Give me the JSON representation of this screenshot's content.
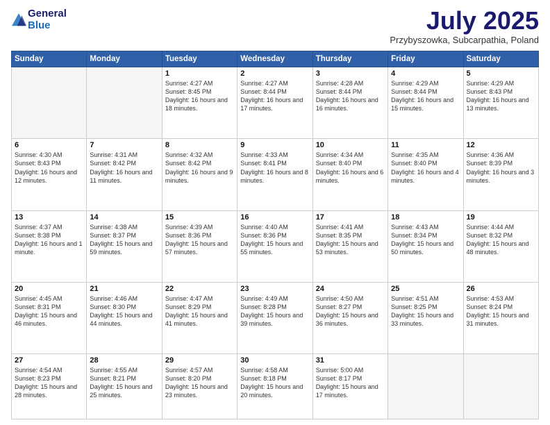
{
  "header": {
    "logo_line1": "General",
    "logo_line2": "Blue",
    "month": "July 2025",
    "location": "Przybyszowka, Subcarpathia, Poland"
  },
  "days_of_week": [
    "Sunday",
    "Monday",
    "Tuesday",
    "Wednesday",
    "Thursday",
    "Friday",
    "Saturday"
  ],
  "weeks": [
    [
      {
        "day": "",
        "text": ""
      },
      {
        "day": "",
        "text": ""
      },
      {
        "day": "1",
        "text": "Sunrise: 4:27 AM\nSunset: 8:45 PM\nDaylight: 16 hours and 18 minutes."
      },
      {
        "day": "2",
        "text": "Sunrise: 4:27 AM\nSunset: 8:44 PM\nDaylight: 16 hours and 17 minutes."
      },
      {
        "day": "3",
        "text": "Sunrise: 4:28 AM\nSunset: 8:44 PM\nDaylight: 16 hours and 16 minutes."
      },
      {
        "day": "4",
        "text": "Sunrise: 4:29 AM\nSunset: 8:44 PM\nDaylight: 16 hours and 15 minutes."
      },
      {
        "day": "5",
        "text": "Sunrise: 4:29 AM\nSunset: 8:43 PM\nDaylight: 16 hours and 13 minutes."
      }
    ],
    [
      {
        "day": "6",
        "text": "Sunrise: 4:30 AM\nSunset: 8:43 PM\nDaylight: 16 hours and 12 minutes."
      },
      {
        "day": "7",
        "text": "Sunrise: 4:31 AM\nSunset: 8:42 PM\nDaylight: 16 hours and 11 minutes."
      },
      {
        "day": "8",
        "text": "Sunrise: 4:32 AM\nSunset: 8:42 PM\nDaylight: 16 hours and 9 minutes."
      },
      {
        "day": "9",
        "text": "Sunrise: 4:33 AM\nSunset: 8:41 PM\nDaylight: 16 hours and 8 minutes."
      },
      {
        "day": "10",
        "text": "Sunrise: 4:34 AM\nSunset: 8:40 PM\nDaylight: 16 hours and 6 minutes."
      },
      {
        "day": "11",
        "text": "Sunrise: 4:35 AM\nSunset: 8:40 PM\nDaylight: 16 hours and 4 minutes."
      },
      {
        "day": "12",
        "text": "Sunrise: 4:36 AM\nSunset: 8:39 PM\nDaylight: 16 hours and 3 minutes."
      }
    ],
    [
      {
        "day": "13",
        "text": "Sunrise: 4:37 AM\nSunset: 8:38 PM\nDaylight: 16 hours and 1 minute."
      },
      {
        "day": "14",
        "text": "Sunrise: 4:38 AM\nSunset: 8:37 PM\nDaylight: 15 hours and 59 minutes."
      },
      {
        "day": "15",
        "text": "Sunrise: 4:39 AM\nSunset: 8:36 PM\nDaylight: 15 hours and 57 minutes."
      },
      {
        "day": "16",
        "text": "Sunrise: 4:40 AM\nSunset: 8:36 PM\nDaylight: 15 hours and 55 minutes."
      },
      {
        "day": "17",
        "text": "Sunrise: 4:41 AM\nSunset: 8:35 PM\nDaylight: 15 hours and 53 minutes."
      },
      {
        "day": "18",
        "text": "Sunrise: 4:43 AM\nSunset: 8:34 PM\nDaylight: 15 hours and 50 minutes."
      },
      {
        "day": "19",
        "text": "Sunrise: 4:44 AM\nSunset: 8:32 PM\nDaylight: 15 hours and 48 minutes."
      }
    ],
    [
      {
        "day": "20",
        "text": "Sunrise: 4:45 AM\nSunset: 8:31 PM\nDaylight: 15 hours and 46 minutes."
      },
      {
        "day": "21",
        "text": "Sunrise: 4:46 AM\nSunset: 8:30 PM\nDaylight: 15 hours and 44 minutes."
      },
      {
        "day": "22",
        "text": "Sunrise: 4:47 AM\nSunset: 8:29 PM\nDaylight: 15 hours and 41 minutes."
      },
      {
        "day": "23",
        "text": "Sunrise: 4:49 AM\nSunset: 8:28 PM\nDaylight: 15 hours and 39 minutes."
      },
      {
        "day": "24",
        "text": "Sunrise: 4:50 AM\nSunset: 8:27 PM\nDaylight: 15 hours and 36 minutes."
      },
      {
        "day": "25",
        "text": "Sunrise: 4:51 AM\nSunset: 8:25 PM\nDaylight: 15 hours and 33 minutes."
      },
      {
        "day": "26",
        "text": "Sunrise: 4:53 AM\nSunset: 8:24 PM\nDaylight: 15 hours and 31 minutes."
      }
    ],
    [
      {
        "day": "27",
        "text": "Sunrise: 4:54 AM\nSunset: 8:23 PM\nDaylight: 15 hours and 28 minutes."
      },
      {
        "day": "28",
        "text": "Sunrise: 4:55 AM\nSunset: 8:21 PM\nDaylight: 15 hours and 25 minutes."
      },
      {
        "day": "29",
        "text": "Sunrise: 4:57 AM\nSunset: 8:20 PM\nDaylight: 15 hours and 23 minutes."
      },
      {
        "day": "30",
        "text": "Sunrise: 4:58 AM\nSunset: 8:18 PM\nDaylight: 15 hours and 20 minutes."
      },
      {
        "day": "31",
        "text": "Sunrise: 5:00 AM\nSunset: 8:17 PM\nDaylight: 15 hours and 17 minutes."
      },
      {
        "day": "",
        "text": ""
      },
      {
        "day": "",
        "text": ""
      }
    ]
  ]
}
